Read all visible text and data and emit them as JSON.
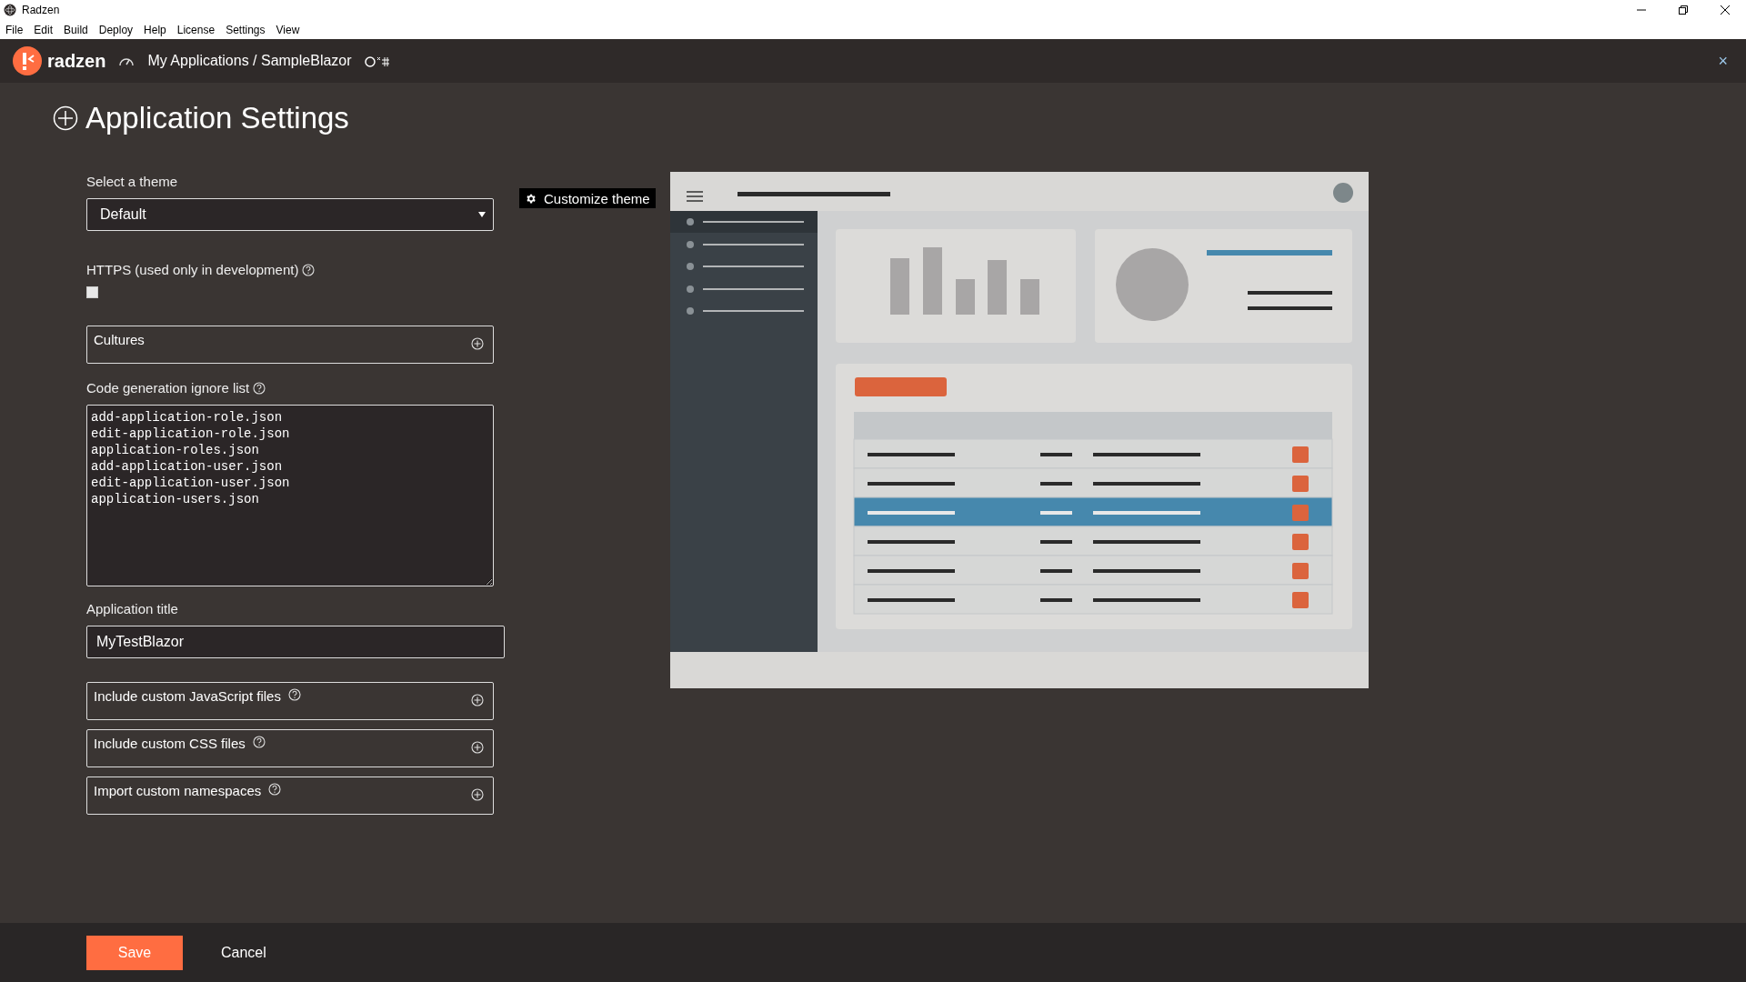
{
  "window": {
    "title": "Radzen"
  },
  "menu": [
    "File",
    "Edit",
    "Build",
    "Deploy",
    "Help",
    "License",
    "Settings",
    "View"
  ],
  "header": {
    "logo_text": "radzen",
    "breadcrumb": "My Applications / SampleBlazor",
    "close": "×"
  },
  "page_title": "Application Settings",
  "theme": {
    "label": "Select a theme",
    "value": "Default",
    "customize": "Customize theme"
  },
  "https": {
    "label": "HTTPS (used only in development)",
    "checked": false
  },
  "cultures": {
    "label": "Cultures"
  },
  "ignore_list": {
    "label": "Code generation ignore list",
    "value": "add-application-role.json\nedit-application-role.json\napplication-roles.json\nadd-application-user.json\nedit-application-user.json\napplication-users.json"
  },
  "app_title": {
    "label": "Application title",
    "value": "MyTestBlazor"
  },
  "sections": [
    {
      "label": "Include custom JavaScript files",
      "help": true
    },
    {
      "label": "Include custom CSS files",
      "help": true
    },
    {
      "label": "Import custom namespaces",
      "help": true
    }
  ],
  "footer": {
    "save": "Save",
    "cancel": "Cancel"
  }
}
